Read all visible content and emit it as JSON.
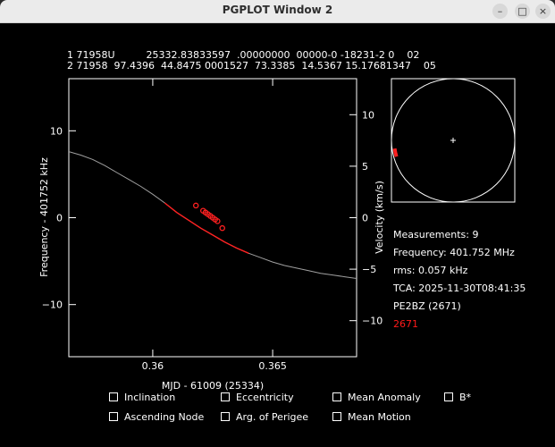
{
  "window": {
    "title": "PGPLOT Window 2",
    "minimize_glyph": "–",
    "maximize_glyph": "□",
    "close_glyph": "×"
  },
  "tle": {
    "line1": "1 71958U          25332.83833597  .00000000  00000-0 -18231-2 0    02",
    "line2": "2 71958  97.4396  44.8475 0001527  73.3385  14.5367 15.17681347    05"
  },
  "info": {
    "measurements": "Measurements: 9",
    "frequency": "Frequency: 401.752 MHz",
    "rms": "rms: 0.057 kHz",
    "tca": "TCA: 2025-11-30T08:41:35",
    "station": "PE2BZ (2671)",
    "station_id": "2671"
  },
  "colors": {
    "curve": "#a0a0a0",
    "fit": "#ff2020",
    "points": "#ff2020",
    "station_id": "#ff1a1a",
    "text": "#ffffff"
  },
  "checkboxes": [
    {
      "label": "Inclination"
    },
    {
      "label": "Eccentricity"
    },
    {
      "label": "Mean Anomaly"
    },
    {
      "label": "B*"
    },
    {
      "label": "Ascending Node"
    },
    {
      "label": "Arg. of Perigee"
    },
    {
      "label": "Mean Motion"
    }
  ],
  "chart_data": {
    "type": "scatter",
    "xlabel": "MJD - 61009 (25334)",
    "ylabel": "Frequency - 401752 kHz",
    "y2label": "Velocity (km/s)",
    "xlim": [
      0.3565,
      0.3685
    ],
    "ylim": [
      -16,
      16
    ],
    "y2lim": [
      -13.5,
      13.5
    ],
    "xticks": [
      {
        "v": 0.36,
        "label": "0.36"
      },
      {
        "v": 0.365,
        "label": "0.365"
      }
    ],
    "yticks": [
      {
        "v": 10,
        "label": "10"
      },
      {
        "v": 0,
        "label": "0"
      },
      {
        "v": -10,
        "label": "−10"
      }
    ],
    "y2ticks": [
      {
        "v": 10,
        "label": "10"
      },
      {
        "v": 5,
        "label": "5"
      },
      {
        "v": 0,
        "label": "0"
      },
      {
        "v": -5,
        "label": "−5"
      },
      {
        "v": -10,
        "label": "−10"
      }
    ],
    "model_curve": {
      "x": [
        0.3565,
        0.357,
        0.3575,
        0.358,
        0.3585,
        0.359,
        0.3595,
        0.36,
        0.3605,
        0.361,
        0.3615,
        0.362,
        0.3625,
        0.363,
        0.3635,
        0.364,
        0.3645,
        0.365,
        0.3655,
        0.366,
        0.3665,
        0.367,
        0.3675,
        0.368,
        0.3685
      ],
      "y": [
        7.6,
        7.2,
        6.7,
        6.0,
        5.2,
        4.4,
        3.6,
        2.7,
        1.7,
        0.6,
        -0.3,
        -1.2,
        -2.0,
        -2.8,
        -3.5,
        -4.1,
        -4.6,
        -5.1,
        -5.5,
        -5.8,
        -6.1,
        -6.4,
        -6.6,
        -6.8,
        -7.0
      ]
    },
    "fit_range": [
      0.3603,
      0.3643
    ],
    "points": {
      "x": [
        0.3618,
        0.3621,
        0.3622,
        0.3623,
        0.3624,
        0.3625,
        0.3626,
        0.3627,
        0.3629
      ],
      "y": [
        1.4,
        0.8,
        0.6,
        0.4,
        0.2,
        0.0,
        -0.2,
        -0.4,
        -1.2
      ]
    },
    "polar": {
      "arc_start_deg": 188,
      "arc_end_deg": 196
    }
  }
}
